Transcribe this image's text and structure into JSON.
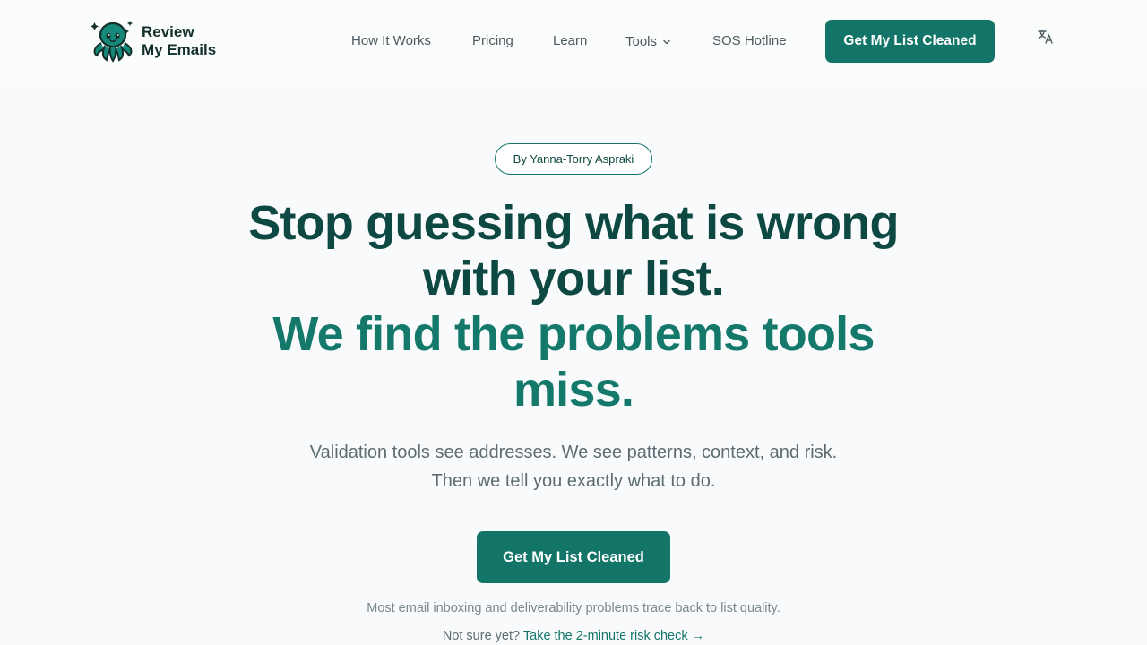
{
  "header": {
    "logo_text": "Review\nMy Emails",
    "nav": {
      "how_it_works": "How It Works",
      "pricing": "Pricing",
      "learn": "Learn",
      "tools": "Tools",
      "sos_hotline": "SOS Hotline"
    },
    "cta_label": "Get My List Cleaned",
    "language_icon": "translate-icon"
  },
  "hero": {
    "author_badge": "By Yanna-Torry Aspraki",
    "headline_line1": "Stop guessing what is wrong with your list.",
    "headline_line2": "We find the problems tools miss.",
    "subheadline": "Validation tools see addresses. We see patterns, context, and risk. Then we tell you exactly what to do.",
    "cta_label": "Get My List Cleaned",
    "note": "Most email inboxing and deliverability problems trace back to list quality.",
    "risk_prefix": "Not sure yet?",
    "risk_link": "Take the 2-minute risk check →"
  },
  "colors": {
    "brand": "#137568",
    "headline_dark": "#0e4842",
    "headline_accent": "#14796b",
    "background": "#f8fafb"
  }
}
